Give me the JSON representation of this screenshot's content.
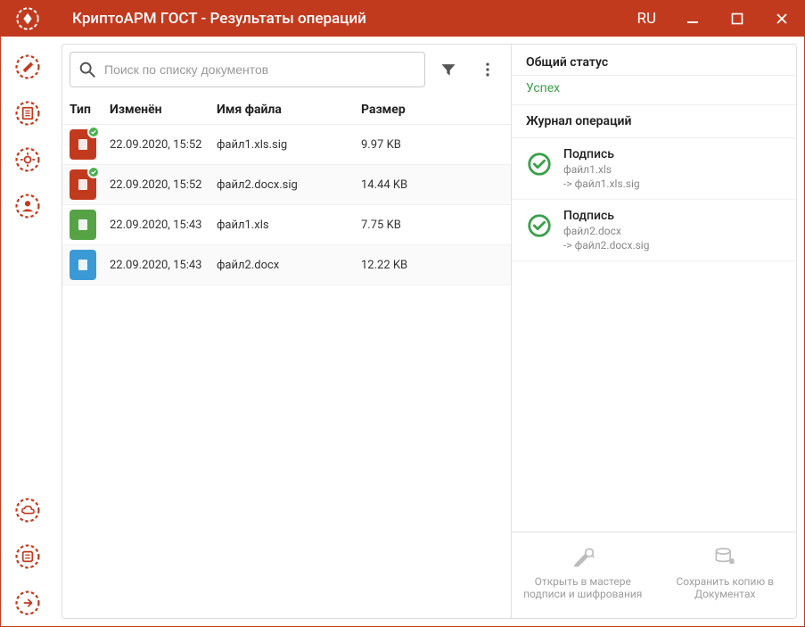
{
  "titlebar": {
    "title": "КриптоАРМ ГОСТ - Результаты операций",
    "lang": "RU"
  },
  "search": {
    "placeholder": "Поиск по списку документов"
  },
  "columns": {
    "type": "Тип",
    "modified": "Изменён",
    "name": "Имя файла",
    "size": "Размер"
  },
  "files": [
    {
      "icon": "sig",
      "modified": "22.09.2020, 15:52",
      "name": "файл1.xls.sig",
      "size": "9.97 KB"
    },
    {
      "icon": "sig",
      "modified": "22.09.2020, 15:52",
      "name": "файл2.docx.sig",
      "size": "14.44 KB"
    },
    {
      "icon": "xls",
      "modified": "22.09.2020, 15:43",
      "name": "файл1.xls",
      "size": "7.75 KB"
    },
    {
      "icon": "docx",
      "modified": "22.09.2020, 15:43",
      "name": "файл2.docx",
      "size": "12.22 KB"
    }
  ],
  "right": {
    "overall_label": "Общий статус",
    "status_text": "Успех",
    "log_label": "Журнал операций",
    "ops": [
      {
        "title": "Подпись",
        "line1": "файл1.xls",
        "line2": "-> файл1.xls.sig"
      },
      {
        "title": "Подпись",
        "line1": "файл2.docx",
        "line2": "-> файл2.docx.sig"
      }
    ],
    "action_open": "Открыть в мастере подписи и шифрования",
    "action_save": "Сохранить копию в Документах"
  },
  "colors": {
    "accent": "#c23a1e",
    "success": "#3aa04a"
  }
}
